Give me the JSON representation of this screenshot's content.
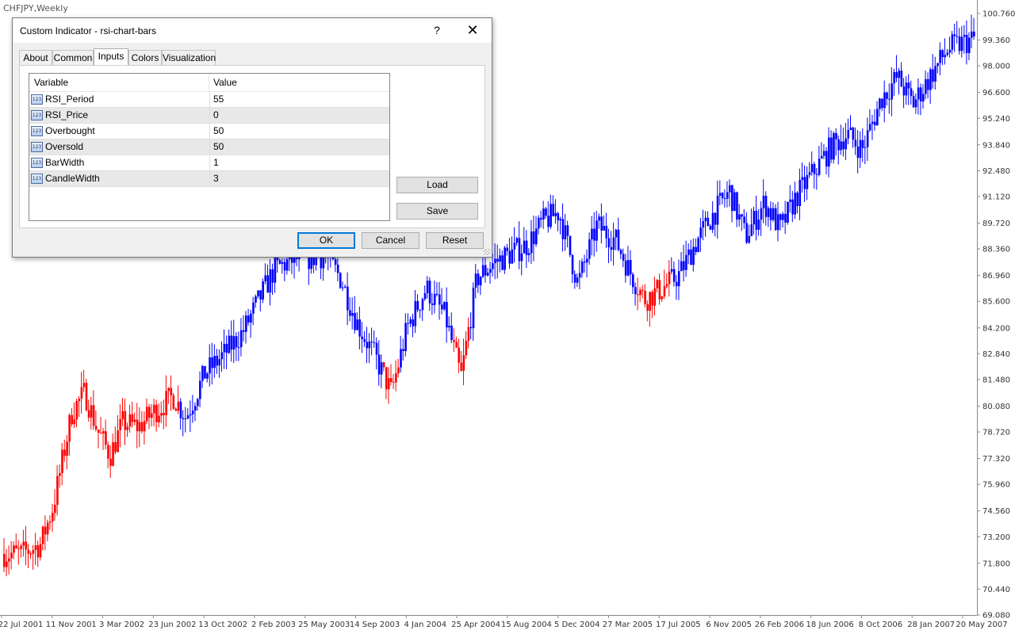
{
  "window": {
    "chart_title": "CHFJPY,Weekly"
  },
  "dialog": {
    "title": "Custom Indicator - rsi-chart-bars",
    "help_label": "?",
    "close_label": "✕",
    "tabs": [
      {
        "label": "About"
      },
      {
        "label": "Common"
      },
      {
        "label": "Inputs",
        "active": true
      },
      {
        "label": "Colors"
      },
      {
        "label": "Visualization"
      }
    ],
    "grid": {
      "headers": {
        "variable": "Variable",
        "value": "Value"
      },
      "icon_text": "123",
      "rows": [
        {
          "variable": "RSI_Period",
          "value": "55"
        },
        {
          "variable": "RSI_Price",
          "value": "0"
        },
        {
          "variable": "Overbought",
          "value": "50"
        },
        {
          "variable": "Oversold",
          "value": "50"
        },
        {
          "variable": "BarWidth",
          "value": "1"
        },
        {
          "variable": "CandleWidth",
          "value": "3"
        }
      ]
    },
    "buttons": {
      "load": "Load",
      "save": "Save",
      "ok": "OK",
      "cancel": "Cancel",
      "reset": "Reset"
    }
  },
  "colors": {
    "bull_bar": "#0000ff",
    "bear_bar": "#ff0000",
    "axis": "#888888"
  },
  "chart_data": {
    "type": "ohlc-bars",
    "symbol": "CHFJPY",
    "timeframe": "Weekly",
    "price_axis": [
      "100.760",
      "99.360",
      "98.000",
      "96.600",
      "95.240",
      "93.840",
      "92.480",
      "91.120",
      "89.720",
      "88.360",
      "86.960",
      "85.600",
      "84.200",
      "82.840",
      "81.480",
      "80.080",
      "78.720",
      "77.320",
      "75.960",
      "74.560",
      "73.200",
      "71.800",
      "70.440",
      "69.080"
    ],
    "ylim": [
      69.08,
      100.76
    ],
    "time_axis": [
      "22 Jul 2001",
      "11 Nov 2001",
      "3 Mar 2002",
      "23 Jun 2002",
      "13 Oct 2002",
      "2 Feb 2003",
      "25 May 2003",
      "14 Sep 2003",
      "4 Jan 2004",
      "25 Apr 2004",
      "15 Aug 2004",
      "5 Dec 2004",
      "27 Mar 2005",
      "17 Jul 2005",
      "6 Nov 2005",
      "26 Feb 2006",
      "18 Jun 2006",
      "8 Oct 2006",
      "28 Jan 2007",
      "20 May 2007"
    ],
    "close_path": [
      {
        "date": "22 Jul 2001",
        "close": 72.3,
        "color": "red"
      },
      {
        "date": "2 Sep 2001",
        "close": 72.8,
        "color": "red"
      },
      {
        "date": "30 Sep 2001",
        "close": 74.8,
        "color": "red"
      },
      {
        "date": "11 Nov 2001",
        "close": 79.8,
        "color": "red"
      },
      {
        "date": "9 Dec 2001",
        "close": 80.8,
        "color": "red"
      },
      {
        "date": "6 Jan 2002",
        "close": 78.8,
        "color": "red"
      },
      {
        "date": "3 Feb 2002",
        "close": 77.5,
        "color": "red"
      },
      {
        "date": "3 Mar 2002",
        "close": 79.2,
        "color": "red"
      },
      {
        "date": "7 Apr 2002",
        "close": 79.0,
        "color": "red"
      },
      {
        "date": "12 May 2002",
        "close": 79.8,
        "color": "red"
      },
      {
        "date": "23 Jun 2002",
        "close": 80.6,
        "color": "red"
      },
      {
        "date": "21 Jul 2002",
        "close": 79.5,
        "color": "blue"
      },
      {
        "date": "1 Sep 2002",
        "close": 81.8,
        "color": "blue"
      },
      {
        "date": "13 Oct 2002",
        "close": 82.8,
        "color": "blue"
      },
      {
        "date": "24 Nov 2002",
        "close": 84.0,
        "color": "blue"
      },
      {
        "date": "2 Feb 2003",
        "close": 87.3,
        "color": "blue"
      },
      {
        "date": "16 Mar 2003",
        "close": 87.8,
        "color": "blue"
      },
      {
        "date": "25 May 2003",
        "close": 88.0,
        "color": "blue"
      },
      {
        "date": "29 Jun 2003",
        "close": 86.8,
        "color": "blue"
      },
      {
        "date": "3 Aug 2003",
        "close": 84.5,
        "color": "blue"
      },
      {
        "date": "14 Sep 2003",
        "close": 82.6,
        "color": "blue"
      },
      {
        "date": "19 Oct 2003",
        "close": 80.8,
        "color": "red"
      },
      {
        "date": "23 Nov 2003",
        "close": 84.2,
        "color": "blue"
      },
      {
        "date": "4 Jan 2004",
        "close": 86.3,
        "color": "blue"
      },
      {
        "date": "15 Feb 2004",
        "close": 84.8,
        "color": "blue"
      },
      {
        "date": "21 Mar 2004",
        "close": 81.6,
        "color": "red"
      },
      {
        "date": "25 Apr 2004",
        "close": 86.8,
        "color": "blue"
      },
      {
        "date": "30 May 2004",
        "close": 87.6,
        "color": "blue"
      },
      {
        "date": "15 Aug 2004",
        "close": 88.6,
        "color": "blue"
      },
      {
        "date": "19 Sep 2004",
        "close": 89.8,
        "color": "blue"
      },
      {
        "date": "24 Oct 2004",
        "close": 90.3,
        "color": "blue"
      },
      {
        "date": "5 Dec 2004",
        "close": 86.5,
        "color": "blue"
      },
      {
        "date": "16 Jan 2005",
        "close": 89.6,
        "color": "blue"
      },
      {
        "date": "27 Feb 2005",
        "close": 88.8,
        "color": "blue"
      },
      {
        "date": "27 Mar 2005",
        "close": 87.3,
        "color": "blue"
      },
      {
        "date": "1 May 2005",
        "close": 85.7,
        "color": "red"
      },
      {
        "date": "5 Jun 2005",
        "close": 86.2,
        "color": "red"
      },
      {
        "date": "17 Jul 2005",
        "close": 87.0,
        "color": "blue"
      },
      {
        "date": "21 Aug 2005",
        "close": 88.6,
        "color": "blue"
      },
      {
        "date": "25 Sep 2005",
        "close": 90.0,
        "color": "blue"
      },
      {
        "date": "6 Nov 2005",
        "close": 91.4,
        "color": "blue"
      },
      {
        "date": "11 Dec 2005",
        "close": 89.0,
        "color": "blue"
      },
      {
        "date": "22 Jan 2006",
        "close": 90.8,
        "color": "blue"
      },
      {
        "date": "26 Feb 2006",
        "close": 89.4,
        "color": "blue"
      },
      {
        "date": "2 Apr 2006",
        "close": 91.1,
        "color": "blue"
      },
      {
        "date": "7 May 2006",
        "close": 92.3,
        "color": "blue"
      },
      {
        "date": "18 Jun 2006",
        "close": 93.7,
        "color": "blue"
      },
      {
        "date": "23 Jul 2006",
        "close": 94.4,
        "color": "blue"
      },
      {
        "date": "27 Aug 2006",
        "close": 93.6,
        "color": "blue"
      },
      {
        "date": "8 Oct 2006",
        "close": 96.3,
        "color": "blue"
      },
      {
        "date": "12 Nov 2006",
        "close": 97.4,
        "color": "blue"
      },
      {
        "date": "17 Dec 2006",
        "close": 96.0,
        "color": "blue"
      },
      {
        "date": "28 Jan 2007",
        "close": 97.6,
        "color": "blue"
      },
      {
        "date": "4 Mar 2007",
        "close": 98.9,
        "color": "blue"
      },
      {
        "date": "20 May 2007",
        "close": 99.6,
        "color": "blue"
      }
    ]
  }
}
